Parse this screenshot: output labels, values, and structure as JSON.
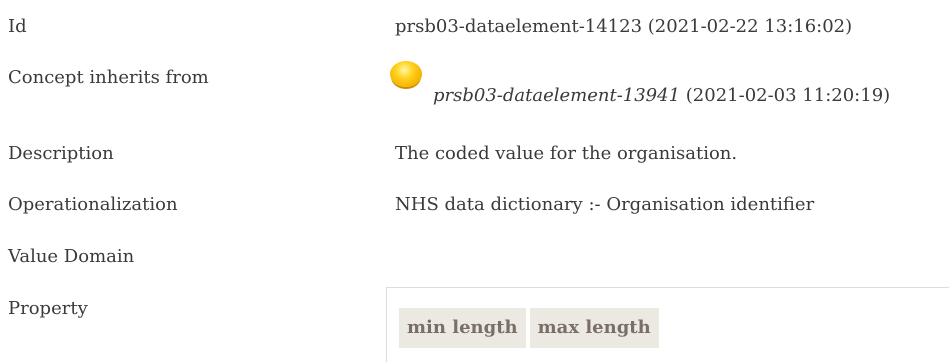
{
  "rows": {
    "id": {
      "label": "Id",
      "value": "prsb03-dataelement-14123 (2021-02-22 13:16:02)"
    },
    "inherits": {
      "label": "Concept inherits from",
      "link": "prsb03-dataelement-13941",
      "date": "(2021-02-03 11:20:19)",
      "icon": "yellow-circle-icon"
    },
    "description": {
      "label": "Description",
      "value": "The coded value for the organisation."
    },
    "operationalization": {
      "label": "Operationalization",
      "value": "NHS data dictionary :- Organisation identifier"
    },
    "value_domain": {
      "label": "Value Domain"
    },
    "property": {
      "label": "Property",
      "columns": [
        "min length",
        "max length"
      ]
    }
  },
  "colors": {
    "text": "#3a3a3a",
    "header_bg": "#ece9e3",
    "header_text": "#7a6f66",
    "icon": "#ffd21f"
  }
}
